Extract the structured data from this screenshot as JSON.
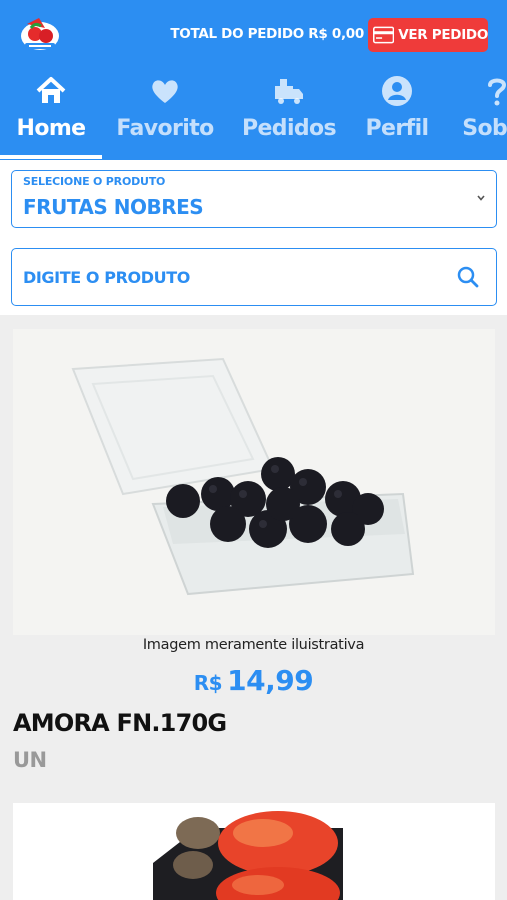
{
  "header": {
    "total_label": "TOTAL DO PEDIDO R$ 0,00",
    "ver_pedido_label": "VER PEDIDO",
    "logo_icon": "store-logo-icon",
    "card_icon": "card-icon",
    "colors": {
      "primary": "#2c8ef2",
      "button_red": "#ef3b3a"
    }
  },
  "nav": {
    "items": [
      {
        "label": "Home",
        "icon": "home-icon",
        "active": true
      },
      {
        "label": "Favorito",
        "icon": "heart-icon",
        "active": false
      },
      {
        "label": "Pedidos",
        "icon": "truck-icon",
        "active": false
      },
      {
        "label": "Perfil",
        "icon": "user-icon",
        "active": false
      },
      {
        "label": "Sobre",
        "icon": "help-icon",
        "active": false
      }
    ]
  },
  "filters": {
    "select_label": "SELECIONE O PRODUTO",
    "select_value": "FRUTAS NOBRES",
    "search_placeholder": "DIGITE O PRODUTO"
  },
  "products": [
    {
      "caption": "Imagem meramente iluistrativa",
      "currency": "R$",
      "price": "14,99",
      "name": "AMORA FN.170G",
      "unit": "UN"
    },
    {
      "caption": "",
      "currency": "",
      "price": "",
      "name": "",
      "unit": ""
    }
  ]
}
